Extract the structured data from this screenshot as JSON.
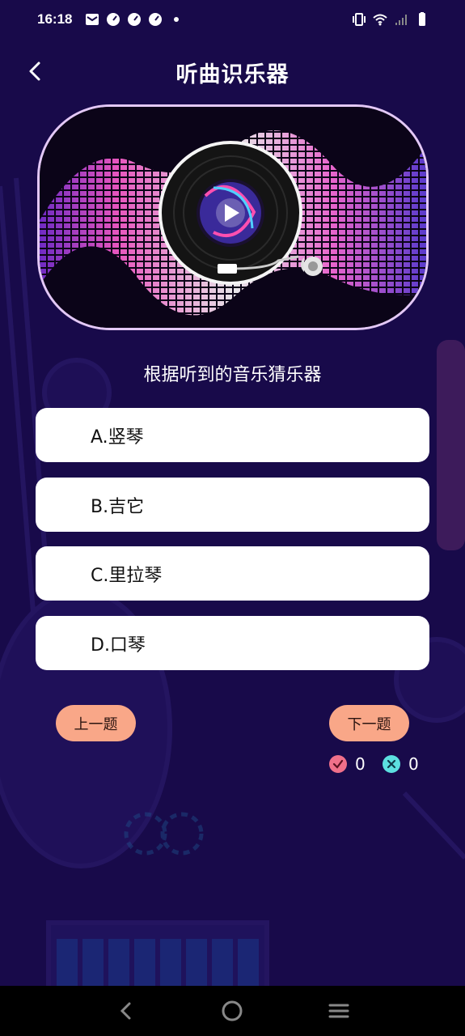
{
  "status_bar": {
    "time": "16:18"
  },
  "header": {
    "title": "听曲识乐器",
    "back_icon": "chevron-left-icon"
  },
  "player": {
    "icon": "play-icon"
  },
  "quiz": {
    "question": "根据听到的音乐猜乐器",
    "options": [
      {
        "label": "A.竖琴"
      },
      {
        "label": "B.吉它"
      },
      {
        "label": "C.里拉琴"
      },
      {
        "label": "D.口琴"
      }
    ],
    "prev_label": "上一题",
    "next_label": "下一题",
    "correct_count": "0",
    "wrong_count": "0"
  },
  "colors": {
    "background": "#180a4a",
    "nav_button": "#f9a788",
    "correct": "#f0708a",
    "wrong": "#5ce0e0"
  }
}
